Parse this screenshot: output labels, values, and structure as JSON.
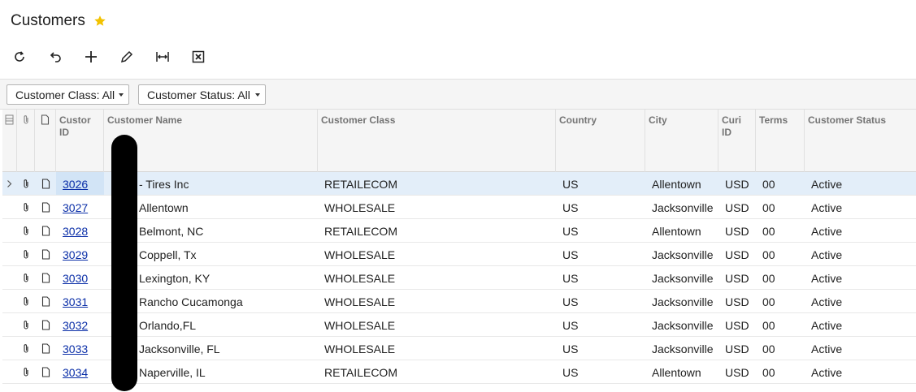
{
  "page": {
    "title": "Customers",
    "star_color": "#f2c200"
  },
  "toolbar": [
    {
      "name": "refresh-button",
      "icon": "refresh-icon"
    },
    {
      "name": "undo-button",
      "icon": "undo-icon"
    },
    {
      "name": "add-button",
      "icon": "plus-icon"
    },
    {
      "name": "edit-button",
      "icon": "pencil-icon"
    },
    {
      "name": "fit-columns-button",
      "icon": "fit-width-icon"
    },
    {
      "name": "export-excel-button",
      "icon": "excel-icon"
    }
  ],
  "filters": {
    "customer_class": "Customer Class: All",
    "customer_status": "Customer Status: All"
  },
  "grid": {
    "headers": {
      "customer_id": [
        "Custor",
        "ID"
      ],
      "customer_name": "Customer Name",
      "customer_class": "Customer Class",
      "country": "Country",
      "city": "City",
      "currency_id": [
        "Curi",
        "ID"
      ],
      "terms": "Terms",
      "customer_status": "Customer Status"
    },
    "rows": [
      {
        "id": "3026",
        "name": "- Tires Inc",
        "class": "RETAILECOM",
        "country": "US",
        "city": "Allentown",
        "cury": "USD",
        "terms": "00",
        "status": "Active"
      },
      {
        "id": "3027",
        "name": "Allentown",
        "class": "WHOLESALE",
        "country": "US",
        "city": "Jacksonville",
        "cury": "USD",
        "terms": "00",
        "status": "Active"
      },
      {
        "id": "3028",
        "name": "Belmont, NC",
        "class": "RETAILECOM",
        "country": "US",
        "city": "Allentown",
        "cury": "USD",
        "terms": "00",
        "status": "Active"
      },
      {
        "id": "3029",
        "name": "Coppell, Tx",
        "class": "WHOLESALE",
        "country": "US",
        "city": "Jacksonville",
        "cury": "USD",
        "terms": "00",
        "status": "Active"
      },
      {
        "id": "3030",
        "name": "Lexington, KY",
        "class": "WHOLESALE",
        "country": "US",
        "city": "Jacksonville",
        "cury": "USD",
        "terms": "00",
        "status": "Active"
      },
      {
        "id": "3031",
        "name": "Rancho Cucamonga",
        "class": "WHOLESALE",
        "country": "US",
        "city": "Jacksonville",
        "cury": "USD",
        "terms": "00",
        "status": "Active"
      },
      {
        "id": "3032",
        "name": "Orlando,FL",
        "class": "WHOLESALE",
        "country": "US",
        "city": "Jacksonville",
        "cury": "USD",
        "terms": "00",
        "status": "Active"
      },
      {
        "id": "3033",
        "name": "Jacksonville, FL",
        "class": "WHOLESALE",
        "country": "US",
        "city": "Jacksonville",
        "cury": "USD",
        "terms": "00",
        "status": "Active"
      },
      {
        "id": "3034",
        "name": "Naperville, IL",
        "class": "RETAILECOM",
        "country": "US",
        "city": "Allentown",
        "cury": "USD",
        "terms": "00",
        "status": "Active"
      }
    ]
  }
}
